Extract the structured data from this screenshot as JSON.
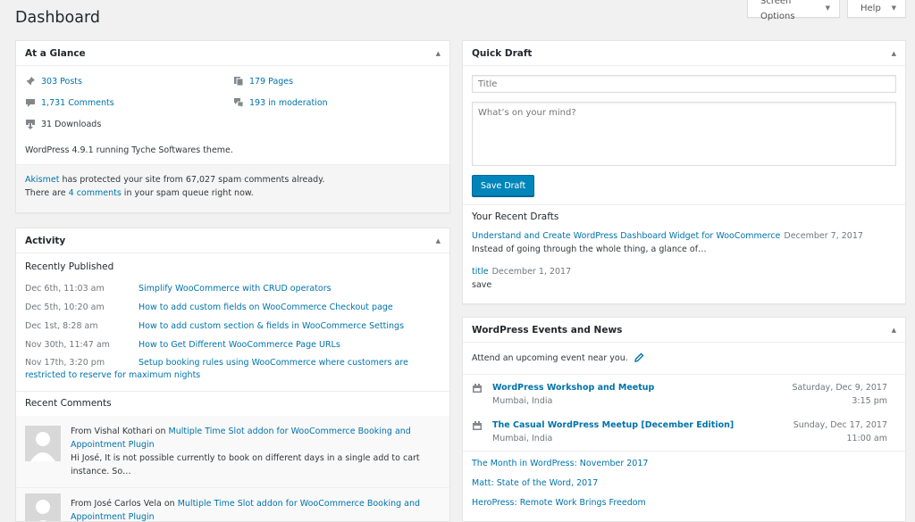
{
  "page": {
    "title": "Dashboard"
  },
  "screen_meta": {
    "screen_options": "Screen Options",
    "help": "Help"
  },
  "at_a_glance": {
    "title": "At a Glance",
    "items": [
      {
        "label": "303 Posts",
        "icon": "pin-icon"
      },
      {
        "label": "179 Pages",
        "icon": "pages-icon"
      },
      {
        "label": "1,731 Comments",
        "icon": "comment-icon"
      },
      {
        "label": "193 in moderation",
        "icon": "comments-moderation-icon"
      },
      {
        "label": "31 Downloads",
        "icon": "download-icon"
      }
    ],
    "footer": "WordPress 4.9.1 running Tyche Softwares theme.",
    "akismet": {
      "link": "Akismet",
      "line1_rest": " has protected your site from 67,027 spam comments already.",
      "line2_pre": "There are ",
      "line2_link": "4 comments",
      "line2_post": " in your spam queue right now."
    }
  },
  "activity": {
    "title": "Activity",
    "recently_published_label": "Recently Published",
    "posts": [
      {
        "date": "Dec 6th, 11:03 am",
        "title": "Simplify WooCommerce with CRUD operators"
      },
      {
        "date": "Dec 5th, 10:20 am",
        "title": "How to add custom fields on WooCommerce Checkout page"
      },
      {
        "date": "Dec 1st, 8:28 am",
        "title": "How to add custom section & fields in WooCommerce Settings"
      },
      {
        "date": "Nov 30th, 11:47 am",
        "title": "How to Get Different WooCommerce Page URLs"
      },
      {
        "date": "Nov 17th, 3:20 pm",
        "title": "Setup booking rules using WooCommerce where customers are restricted to reserve for maximum nights"
      }
    ],
    "recent_comments_label": "Recent Comments",
    "comments": [
      {
        "from": "From Vishal Kothari on ",
        "post": "Multiple Time Slot addon for WooCommerce Booking and Appointment Plugin",
        "excerpt": "Hi José, It is not possible currently to book on different days in a single add to cart instance. So…"
      },
      {
        "from": "From José Carlos Vela on ",
        "post": "Multiple Time Slot addon for WooCommerce Booking and Appointment Plugin",
        "excerpt": ""
      }
    ]
  },
  "quick_draft": {
    "title": "Quick Draft",
    "title_placeholder": "Title",
    "content_placeholder": "What’s on your mind?",
    "save_label": "Save Draft",
    "recent_drafts_label": "Your Recent Drafts",
    "drafts": [
      {
        "title": "Understand and Create WordPress Dashboard Widget for WooCommerce",
        "date": "December 7, 2017",
        "excerpt": "Instead of going through the whole thing, a glance of…"
      },
      {
        "title": "title",
        "date": "December 1, 2017",
        "excerpt": "save"
      }
    ]
  },
  "events_news": {
    "title": "WordPress Events and News",
    "intro": "Attend an upcoming event near you.",
    "events": [
      {
        "title": "WordPress Workshop and Meetup",
        "location": "Mumbai, India",
        "date": "Saturday, Dec 9, 2017",
        "time": "3:15 pm"
      },
      {
        "title": "The Casual WordPress Meetup [December Edition]",
        "location": "Mumbai, India",
        "date": "Sunday, Dec 17, 2017",
        "time": "11:00 am"
      }
    ],
    "news": [
      "The Month in WordPress: November 2017",
      "Matt: State of the Word, 2017",
      "HeroPress: Remote Work Brings Freedom"
    ]
  },
  "colors": {
    "link": "#0073aa",
    "primary_button": "#0085ba",
    "background": "#f1f1f1"
  }
}
